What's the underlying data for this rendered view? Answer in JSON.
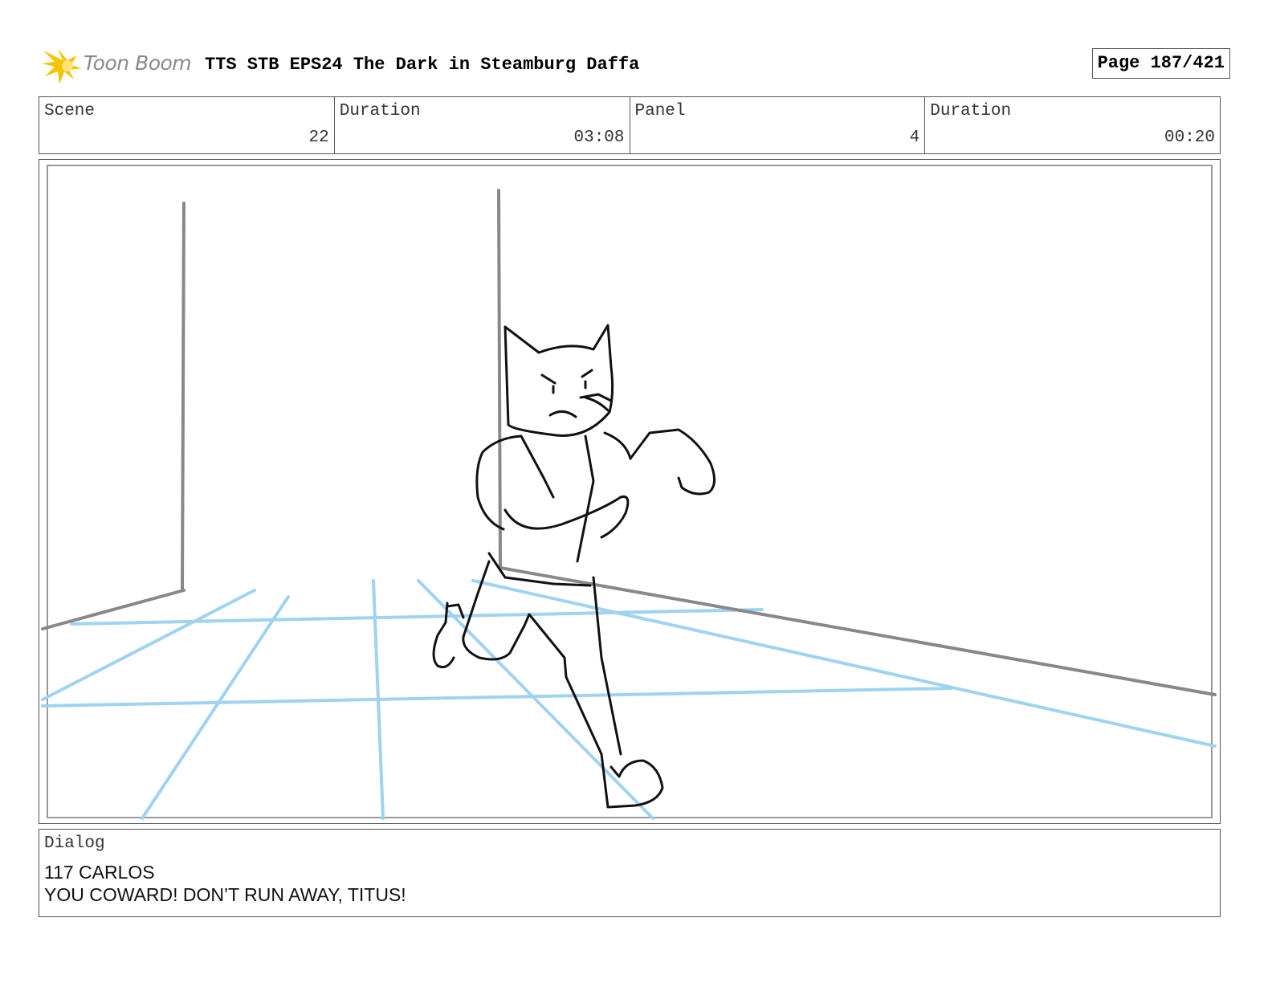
{
  "header": {
    "logo_text": "Toon Boom",
    "title": "TTS STB EPS24 The Dark in Steamburg Daffa",
    "page": "Page 187/421"
  },
  "info": {
    "scene_label": "Scene",
    "scene_value": "22",
    "scene_duration_label": "Duration",
    "scene_duration_value": "03:08",
    "panel_label": "Panel",
    "panel_value": "4",
    "panel_duration_label": "Duration",
    "panel_duration_value": "00:20"
  },
  "panel_art": {
    "description_icon": "storyboard-sketch",
    "guide_color": "#9fd3f0",
    "line_color": "#111111",
    "wall_color": "#888888"
  },
  "dialog": {
    "label": "Dialog",
    "line1": "117 CARLOS",
    "line2": "YOU COWARD! DON’T RUN AWAY, TITUS!"
  }
}
